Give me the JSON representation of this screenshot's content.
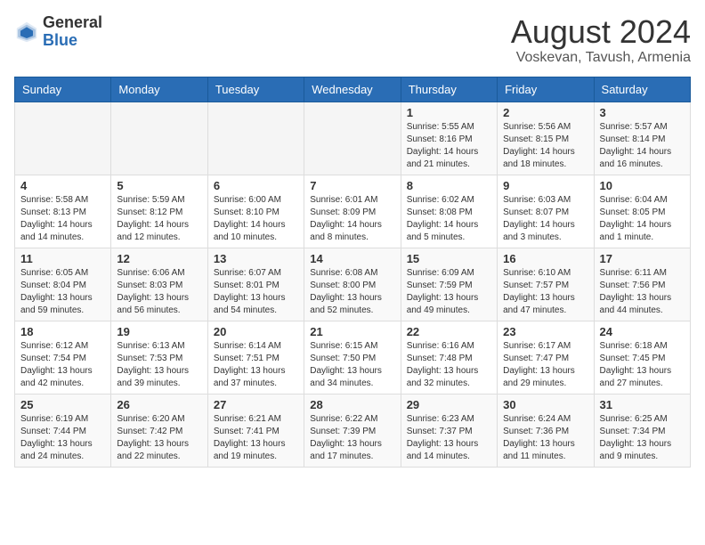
{
  "logo": {
    "general": "General",
    "blue": "Blue"
  },
  "title": {
    "month_year": "August 2024",
    "location": "Voskevan, Tavush, Armenia"
  },
  "days_of_week": [
    "Sunday",
    "Monday",
    "Tuesday",
    "Wednesday",
    "Thursday",
    "Friday",
    "Saturday"
  ],
  "weeks": [
    [
      {
        "day": "",
        "info": ""
      },
      {
        "day": "",
        "info": ""
      },
      {
        "day": "",
        "info": ""
      },
      {
        "day": "",
        "info": ""
      },
      {
        "day": "1",
        "info": "Sunrise: 5:55 AM\nSunset: 8:16 PM\nDaylight: 14 hours\nand 21 minutes."
      },
      {
        "day": "2",
        "info": "Sunrise: 5:56 AM\nSunset: 8:15 PM\nDaylight: 14 hours\nand 18 minutes."
      },
      {
        "day": "3",
        "info": "Sunrise: 5:57 AM\nSunset: 8:14 PM\nDaylight: 14 hours\nand 16 minutes."
      }
    ],
    [
      {
        "day": "4",
        "info": "Sunrise: 5:58 AM\nSunset: 8:13 PM\nDaylight: 14 hours\nand 14 minutes."
      },
      {
        "day": "5",
        "info": "Sunrise: 5:59 AM\nSunset: 8:12 PM\nDaylight: 14 hours\nand 12 minutes."
      },
      {
        "day": "6",
        "info": "Sunrise: 6:00 AM\nSunset: 8:10 PM\nDaylight: 14 hours\nand 10 minutes."
      },
      {
        "day": "7",
        "info": "Sunrise: 6:01 AM\nSunset: 8:09 PM\nDaylight: 14 hours\nand 8 minutes."
      },
      {
        "day": "8",
        "info": "Sunrise: 6:02 AM\nSunset: 8:08 PM\nDaylight: 14 hours\nand 5 minutes."
      },
      {
        "day": "9",
        "info": "Sunrise: 6:03 AM\nSunset: 8:07 PM\nDaylight: 14 hours\nand 3 minutes."
      },
      {
        "day": "10",
        "info": "Sunrise: 6:04 AM\nSunset: 8:05 PM\nDaylight: 14 hours\nand 1 minute."
      }
    ],
    [
      {
        "day": "11",
        "info": "Sunrise: 6:05 AM\nSunset: 8:04 PM\nDaylight: 13 hours\nand 59 minutes."
      },
      {
        "day": "12",
        "info": "Sunrise: 6:06 AM\nSunset: 8:03 PM\nDaylight: 13 hours\nand 56 minutes."
      },
      {
        "day": "13",
        "info": "Sunrise: 6:07 AM\nSunset: 8:01 PM\nDaylight: 13 hours\nand 54 minutes."
      },
      {
        "day": "14",
        "info": "Sunrise: 6:08 AM\nSunset: 8:00 PM\nDaylight: 13 hours\nand 52 minutes."
      },
      {
        "day": "15",
        "info": "Sunrise: 6:09 AM\nSunset: 7:59 PM\nDaylight: 13 hours\nand 49 minutes."
      },
      {
        "day": "16",
        "info": "Sunrise: 6:10 AM\nSunset: 7:57 PM\nDaylight: 13 hours\nand 47 minutes."
      },
      {
        "day": "17",
        "info": "Sunrise: 6:11 AM\nSunset: 7:56 PM\nDaylight: 13 hours\nand 44 minutes."
      }
    ],
    [
      {
        "day": "18",
        "info": "Sunrise: 6:12 AM\nSunset: 7:54 PM\nDaylight: 13 hours\nand 42 minutes."
      },
      {
        "day": "19",
        "info": "Sunrise: 6:13 AM\nSunset: 7:53 PM\nDaylight: 13 hours\nand 39 minutes."
      },
      {
        "day": "20",
        "info": "Sunrise: 6:14 AM\nSunset: 7:51 PM\nDaylight: 13 hours\nand 37 minutes."
      },
      {
        "day": "21",
        "info": "Sunrise: 6:15 AM\nSunset: 7:50 PM\nDaylight: 13 hours\nand 34 minutes."
      },
      {
        "day": "22",
        "info": "Sunrise: 6:16 AM\nSunset: 7:48 PM\nDaylight: 13 hours\nand 32 minutes."
      },
      {
        "day": "23",
        "info": "Sunrise: 6:17 AM\nSunset: 7:47 PM\nDaylight: 13 hours\nand 29 minutes."
      },
      {
        "day": "24",
        "info": "Sunrise: 6:18 AM\nSunset: 7:45 PM\nDaylight: 13 hours\nand 27 minutes."
      }
    ],
    [
      {
        "day": "25",
        "info": "Sunrise: 6:19 AM\nSunset: 7:44 PM\nDaylight: 13 hours\nand 24 minutes."
      },
      {
        "day": "26",
        "info": "Sunrise: 6:20 AM\nSunset: 7:42 PM\nDaylight: 13 hours\nand 22 minutes."
      },
      {
        "day": "27",
        "info": "Sunrise: 6:21 AM\nSunset: 7:41 PM\nDaylight: 13 hours\nand 19 minutes."
      },
      {
        "day": "28",
        "info": "Sunrise: 6:22 AM\nSunset: 7:39 PM\nDaylight: 13 hours\nand 17 minutes."
      },
      {
        "day": "29",
        "info": "Sunrise: 6:23 AM\nSunset: 7:37 PM\nDaylight: 13 hours\nand 14 minutes."
      },
      {
        "day": "30",
        "info": "Sunrise: 6:24 AM\nSunset: 7:36 PM\nDaylight: 13 hours\nand 11 minutes."
      },
      {
        "day": "31",
        "info": "Sunrise: 6:25 AM\nSunset: 7:34 PM\nDaylight: 13 hours\nand 9 minutes."
      }
    ]
  ]
}
